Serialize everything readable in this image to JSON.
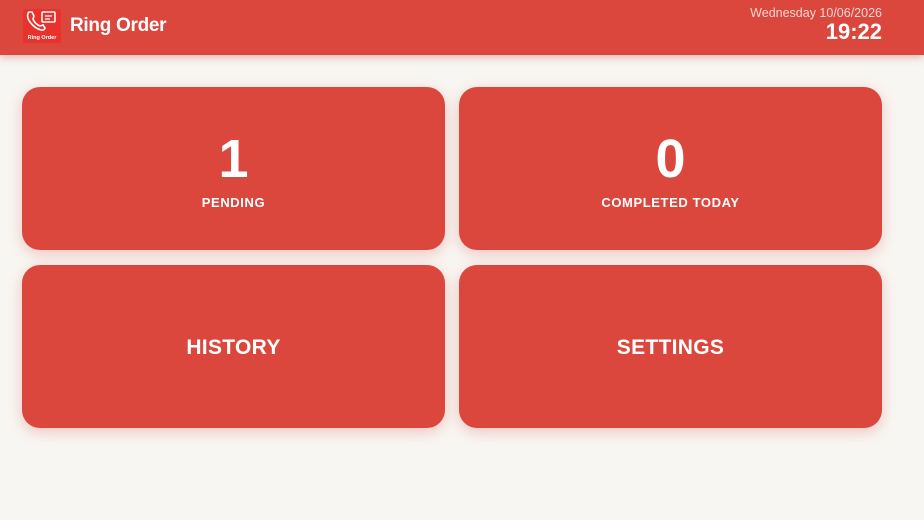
{
  "header": {
    "app_title": "Ring Order",
    "logo_text": "Ring Order",
    "date": "Wednesday 10/06/2026",
    "time": "19:22"
  },
  "cards": {
    "pending": {
      "count": "1",
      "label": "PENDING"
    },
    "completed": {
      "count": "0",
      "label": "COMPLETED TODAY"
    },
    "history": {
      "label": "HISTORY"
    },
    "settings": {
      "label": "SETTINGS"
    }
  },
  "colors": {
    "accent": "#db463d",
    "background": "#f8f6f2",
    "text_on_accent": "#ffffff"
  },
  "icons": {
    "logo": "phone-order-icon"
  }
}
